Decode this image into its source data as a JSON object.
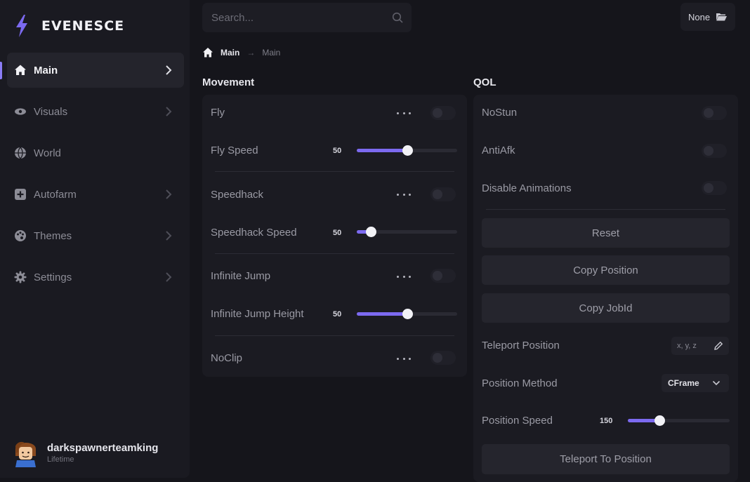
{
  "app": {
    "logo_text": "EVENESCE",
    "accent": "#7c6af0"
  },
  "sidebar": {
    "items": [
      {
        "label": "Main",
        "icon": "home-icon",
        "active": true,
        "has_chevron": true
      },
      {
        "label": "Visuals",
        "icon": "eye-icon",
        "active": false,
        "has_chevron": true
      },
      {
        "label": "World",
        "icon": "globe-icon",
        "active": false,
        "has_chevron": false
      },
      {
        "label": "Autofarm",
        "icon": "plus-square-icon",
        "active": false,
        "has_chevron": true
      },
      {
        "label": "Themes",
        "icon": "palette-icon",
        "active": false,
        "has_chevron": true
      },
      {
        "label": "Settings",
        "icon": "gear-icon",
        "active": false,
        "has_chevron": true
      }
    ],
    "user": {
      "name": "darkspawnerteamking",
      "subtitle": "Lifetime"
    }
  },
  "search": {
    "placeholder": "Search..."
  },
  "config": {
    "label": "None",
    "icon": "folder-icon"
  },
  "breadcrumb": {
    "first": "Main",
    "separator": "→",
    "second": "Main"
  },
  "movement": {
    "title": "Movement",
    "fly": {
      "label": "Fly",
      "enabled": false
    },
    "fly_speed": {
      "label": "Fly Speed",
      "value": "50",
      "fill": 0.5
    },
    "speedhack": {
      "label": "Speedhack",
      "enabled": false
    },
    "speedhack_speed": {
      "label": "Speedhack Speed",
      "value": "50",
      "fill": 0.14
    },
    "infinite_jump": {
      "label": "Infinite Jump",
      "enabled": false
    },
    "infinite_jump_height": {
      "label": "Infinite Jump Height",
      "value": "50",
      "fill": 0.5
    },
    "noclip": {
      "label": "NoClip",
      "enabled": false
    }
  },
  "qol": {
    "title": "QOL",
    "nostun": {
      "label": "NoStun",
      "enabled": false
    },
    "antiafk": {
      "label": "AntiAfk",
      "enabled": false
    },
    "disable_animations": {
      "label": "Disable Animations",
      "enabled": false
    },
    "reset_label": "Reset",
    "copy_position_label": "Copy Position",
    "copy_jobid_label": "Copy JobId",
    "teleport_position": {
      "label": "Teleport Position",
      "placeholder": "x, y, z"
    },
    "position_method": {
      "label": "Position Method",
      "value": "CFrame"
    },
    "position_speed": {
      "label": "Position Speed",
      "value": "150",
      "fill": 0.31
    },
    "teleport_to_position_label": "Teleport To Position"
  }
}
